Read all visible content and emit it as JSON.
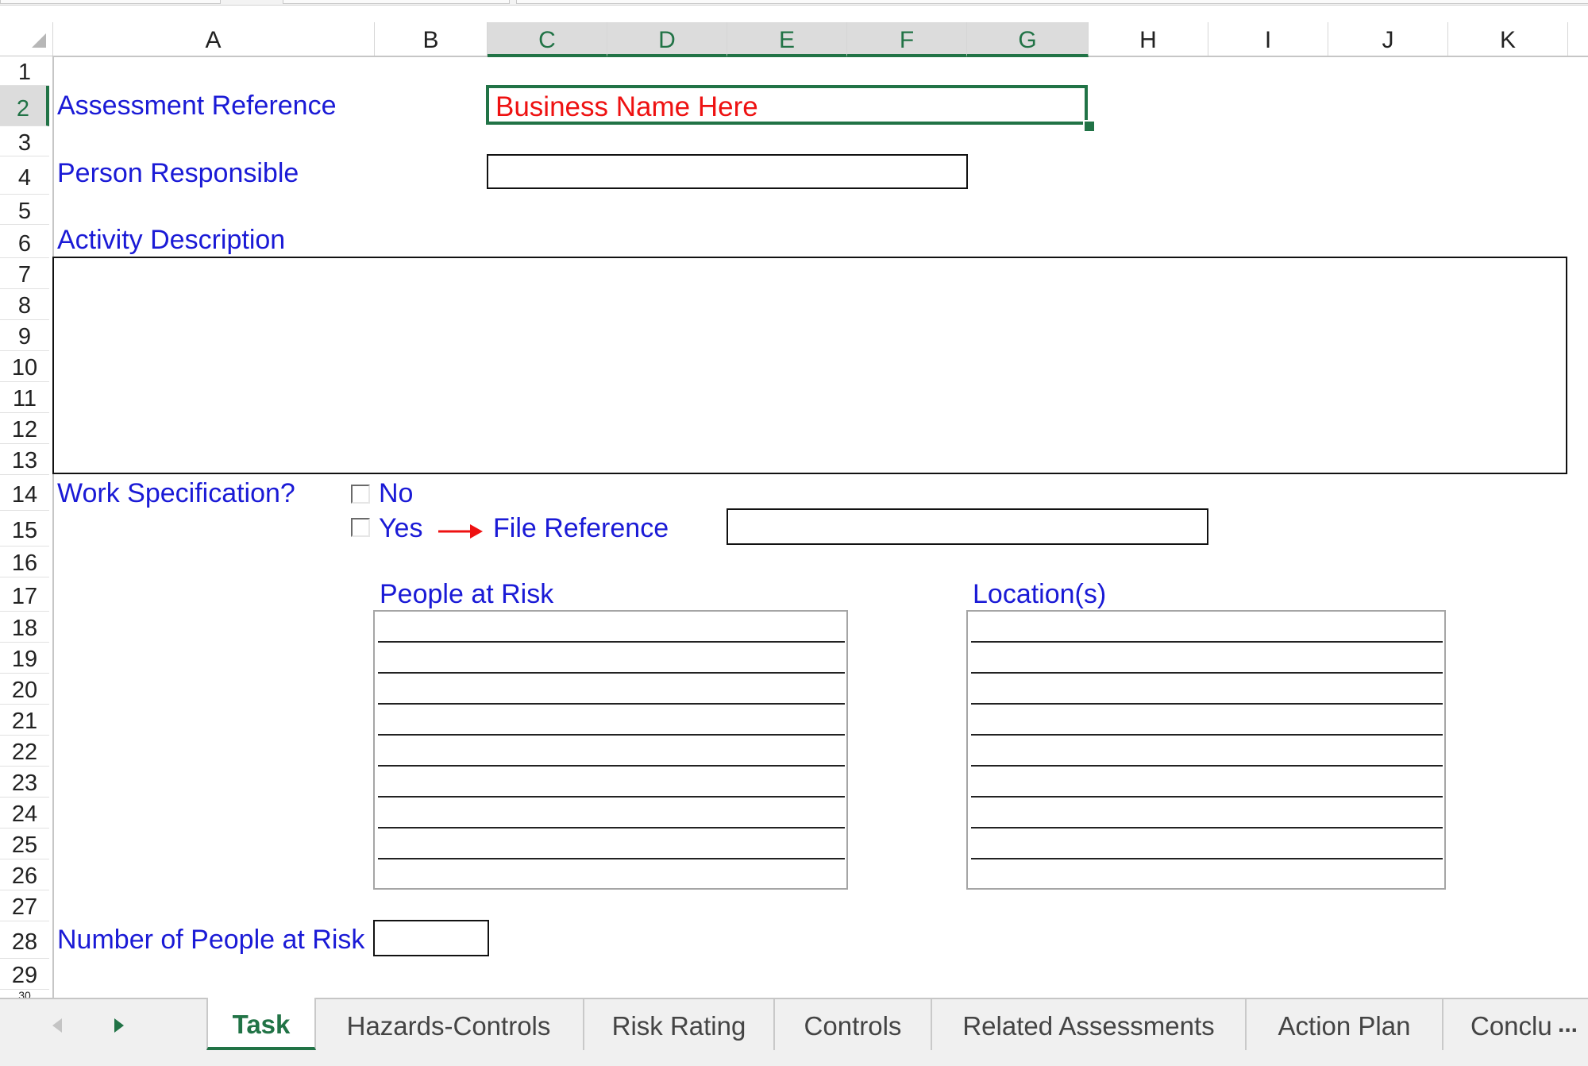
{
  "columns": [
    "A",
    "B",
    "C",
    "D",
    "E",
    "F",
    "G",
    "H",
    "I",
    "J",
    "K"
  ],
  "rows": [
    "1",
    "2",
    "3",
    "4",
    "5",
    "6",
    "7",
    "8",
    "9",
    "10",
    "11",
    "12",
    "13",
    "14",
    "15",
    "16",
    "17",
    "18",
    "19",
    "20",
    "21",
    "22",
    "23",
    "24",
    "25",
    "26",
    "27",
    "28",
    "29",
    "30"
  ],
  "selected_cell": {
    "value": "Business Name Here",
    "color": "#ee1111"
  },
  "labels": {
    "assessment_reference": "Assessment Reference",
    "person_responsible": "Person Responsible",
    "activity_description": "Activity Description",
    "work_specification": "Work Specification?",
    "no": "No",
    "yes": "Yes",
    "file_reference": "File Reference",
    "people_at_risk": "People at Risk",
    "locations": "Location(s)",
    "number_of_people_at_risk": "Number of People at Risk"
  },
  "sheet_tabs": [
    {
      "label": "Task",
      "active": true
    },
    {
      "label": "Hazards-Controls",
      "active": false
    },
    {
      "label": "Risk Rating",
      "active": false
    },
    {
      "label": "Controls",
      "active": false
    },
    {
      "label": "Related Assessments",
      "active": false
    },
    {
      "label": "Action Plan",
      "active": false
    },
    {
      "label": "Conclu",
      "active": false
    }
  ],
  "tab_overflow": "...",
  "colors": {
    "label_blue": "#1a1ad6",
    "accent_green": "#217346",
    "arrow_red": "#ee1111"
  }
}
